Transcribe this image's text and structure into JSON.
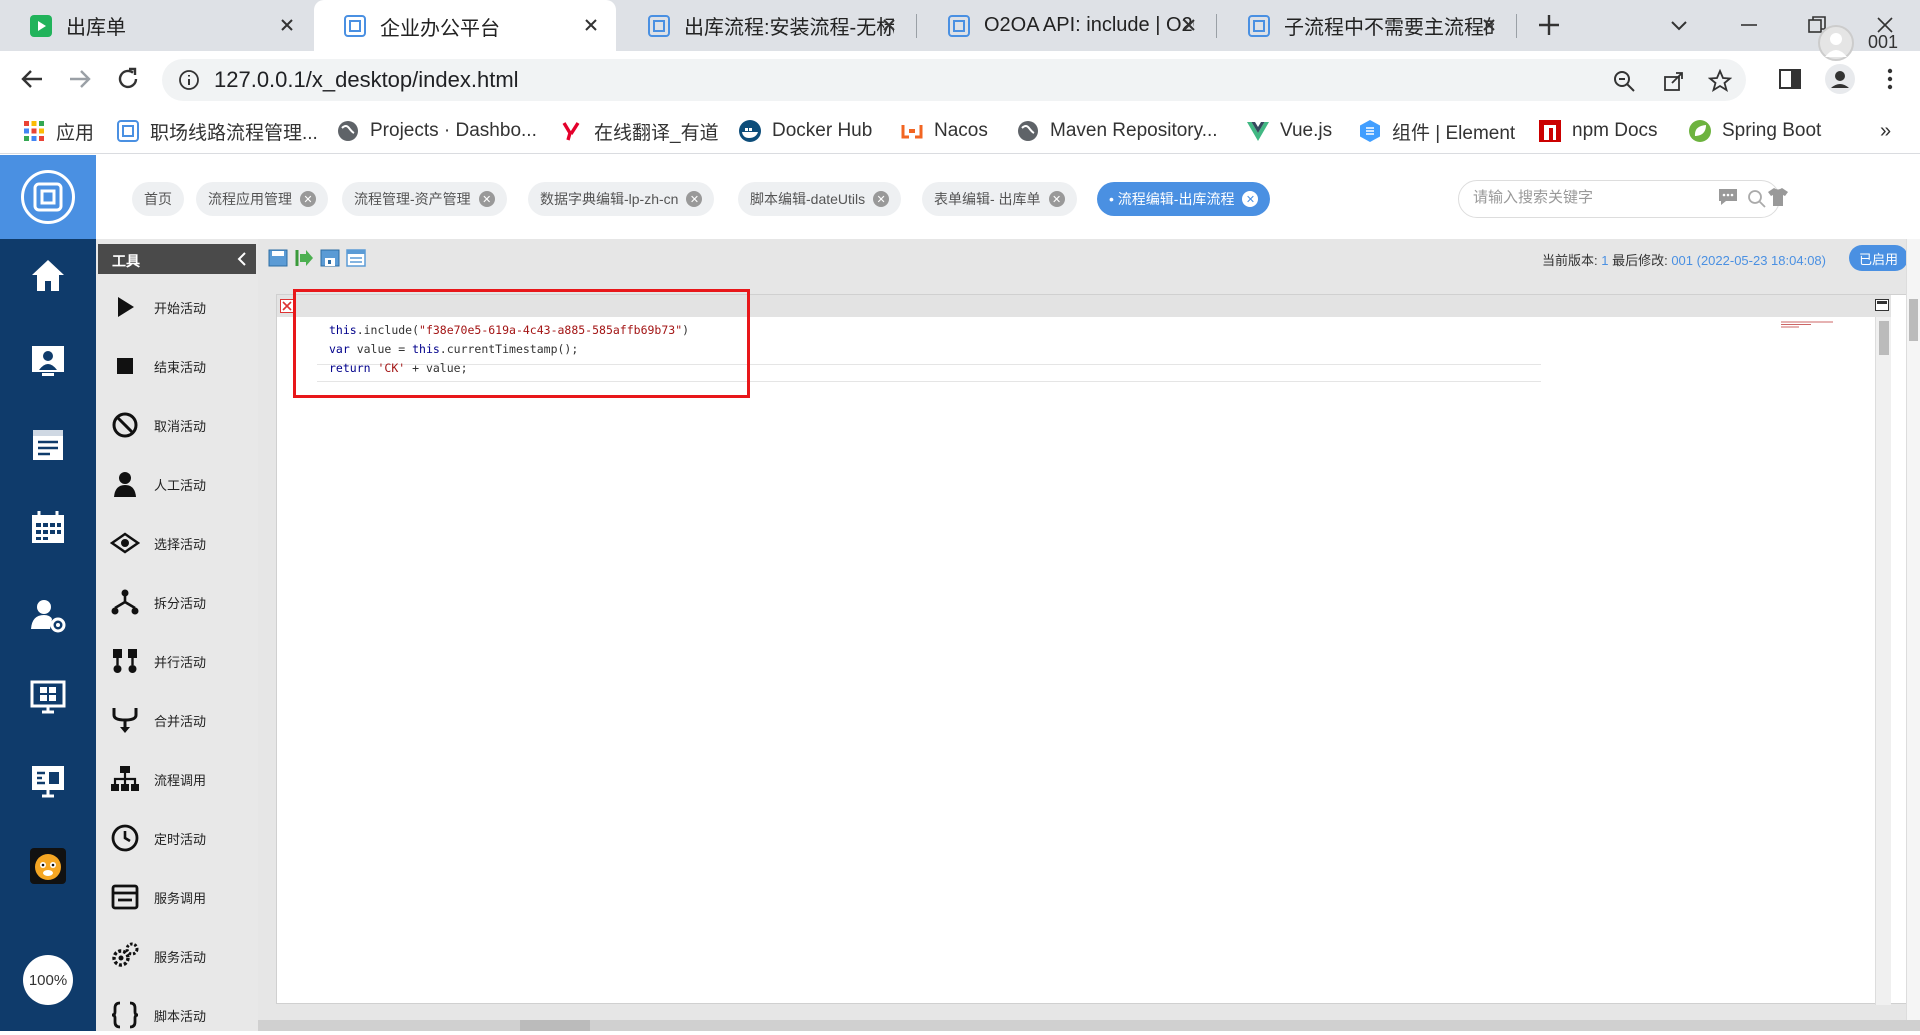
{
  "browser": {
    "tabs": [
      {
        "title": "出库单",
        "active": false
      },
      {
        "title": "企业办公平台",
        "active": true
      },
      {
        "title": "出库流程:安装流程-无标题",
        "active": false
      },
      {
        "title": "O2OA API: include | O2OA",
        "active": false
      },
      {
        "title": "子流程中不需要主流程的数据",
        "active": false
      }
    ],
    "url": "127.0.0.1/x_desktop/index.html",
    "bookmarks": [
      {
        "label": "应用"
      },
      {
        "label": "职场线路流程管理..."
      },
      {
        "label": "Projects · Dashbo..."
      },
      {
        "label": "在线翻译_有道"
      },
      {
        "label": "Docker Hub"
      },
      {
        "label": "Nacos"
      },
      {
        "label": "Maven Repository..."
      },
      {
        "label": "Vue.js"
      },
      {
        "label": "组件 | Element"
      },
      {
        "label": "npm Docs"
      },
      {
        "label": "Spring Boot"
      }
    ]
  },
  "app": {
    "zoom": "100%",
    "nav_tabs": [
      {
        "label": "首页",
        "closable": false,
        "active": false
      },
      {
        "label": "流程应用管理",
        "closable": true,
        "active": false
      },
      {
        "label": "流程管理-资产管理",
        "closable": true,
        "active": false
      },
      {
        "label": "数据字典编辑-lp-zh-cn",
        "closable": true,
        "active": false
      },
      {
        "label": "脚本编辑-dateUtils",
        "closable": true,
        "active": false
      },
      {
        "label": "表单编辑- 出库单",
        "closable": true,
        "active": false
      },
      {
        "label": "• 流程编辑-出库流程",
        "closable": true,
        "active": true
      }
    ],
    "search_placeholder": "请输入搜索关键字",
    "username": "001",
    "palette": {
      "title": "工具",
      "items": [
        {
          "label": "开始活动"
        },
        {
          "label": "结束活动"
        },
        {
          "label": "取消活动"
        },
        {
          "label": "人工活动"
        },
        {
          "label": "选择活动"
        },
        {
          "label": "拆分活动"
        },
        {
          "label": "并行活动"
        },
        {
          "label": "合并活动"
        },
        {
          "label": "流程调用"
        },
        {
          "label": "定时活动"
        },
        {
          "label": "服务调用"
        },
        {
          "label": "服务活动"
        },
        {
          "label": "脚本活动"
        }
      ]
    },
    "version_info": {
      "current_label": "当前版本:",
      "current_value": "1",
      "modified_label": "最后修改:",
      "modified_value": "001 (2022-05-23 18:04:08)",
      "status": "已启用"
    },
    "code_lines": [
      "this.include(\"f38e70e5-619a-4c43-a885-585affb69b73\")",
      "var value = this.currentTimestamp();",
      "return 'CK' + value;"
    ]
  },
  "colors": {
    "accent": "#4a90e2",
    "sidebar": "#0f3b6b",
    "highlight": "#e8171a"
  }
}
